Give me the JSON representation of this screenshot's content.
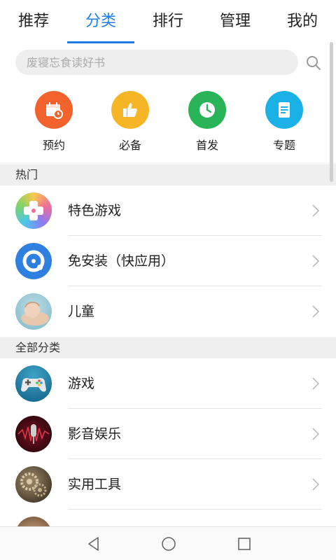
{
  "tabs": [
    {
      "label": "推荐",
      "active": false
    },
    {
      "label": "分类",
      "active": true
    },
    {
      "label": "排行",
      "active": false
    },
    {
      "label": "管理",
      "active": false
    },
    {
      "label": "我的",
      "active": false
    }
  ],
  "search": {
    "placeholder": "废寝忘食读好书"
  },
  "quick": [
    {
      "label": "预约",
      "color": "#f2622d",
      "icon": "calendar-icon"
    },
    {
      "label": "必备",
      "color": "#f5b526",
      "icon": "thumbs-up-icon"
    },
    {
      "label": "首发",
      "color": "#28b457",
      "icon": "clock-icon"
    },
    {
      "label": "专题",
      "color": "#1ab1e6",
      "icon": "document-icon"
    }
  ],
  "sections": {
    "hot": "热门",
    "all": "全部分类"
  },
  "hot_items": [
    {
      "label": "特色游戏",
      "icon": "gamepad-icon"
    },
    {
      "label": "免安装（快应用）",
      "icon": "quick-app-icon"
    },
    {
      "label": "儿童",
      "icon": "baby-icon"
    }
  ],
  "all_items": [
    {
      "label": "游戏",
      "icon": "controller-icon"
    },
    {
      "label": "影音娱乐",
      "icon": "microphone-icon"
    },
    {
      "label": "实用工具",
      "icon": "gears-icon"
    }
  ],
  "accent_color": "#1e7ee6"
}
